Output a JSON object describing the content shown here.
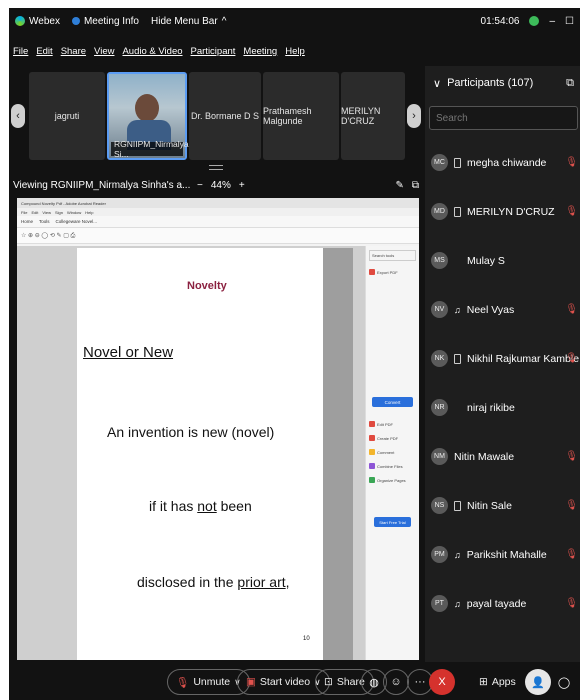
{
  "titlebar": {
    "app_name": "Webex",
    "meeting_info": "Meeting Info",
    "hide_menu": "Hide Menu Bar",
    "hide_menu_chevron": "^",
    "timer": "01:54:06",
    "minimize": "–",
    "maximize": "☐"
  },
  "menu": [
    "File",
    "Edit",
    "Share",
    "View",
    "Audio & Video",
    "Participant",
    "Meeting",
    "Help"
  ],
  "video_strip": {
    "tiles": [
      "jagruti",
      "RGNIIPM_Nirmalya Si...",
      "Dr. Bormane D S",
      "Prathamesh Malgunde",
      "MERILYN D'CRUZ"
    ],
    "left_arrow": "‹",
    "right_arrow": "›"
  },
  "viewing": {
    "title": "Viewing RGNIIPM_Nirmalya Sinha's a...",
    "zoom_out": "−",
    "zoom_level": "44%",
    "zoom_in": "+"
  },
  "shared_doc": {
    "browser_tab": "Compound Novelty Pdf - Adobe Acrobat Reader",
    "browser_menu": [
      "File",
      "Edit",
      "View",
      "Sign",
      "Window",
      "Help"
    ],
    "tabs": [
      "Home",
      "Tools",
      "Collegeware Novel..."
    ],
    "page_texts": {
      "heading": "Novelty",
      "subheading": "Novel or New",
      "line1": "An invention is new (novel)",
      "line2_prefix": "if it has ",
      "line2_underlined": "not",
      "line2_suffix": " been",
      "line3_prefix": "disclosed in the ",
      "line3_underlined": "prior art",
      "line3_suffix": ",",
      "page_number": "10"
    },
    "side_panel": {
      "search": "Search tools",
      "items": [
        "Export PDF",
        "Edit PDF",
        "Create PDF",
        "Comment",
        "Combine Files",
        "Organize Pages"
      ],
      "convert_button": "Convert",
      "free_trial": "Start Free Trial"
    }
  },
  "participants": {
    "title": "Participants (107)",
    "search_placeholder": "Search",
    "list": [
      {
        "initials": "MC",
        "name": "megha chiwande",
        "device": "phone",
        "muted": true
      },
      {
        "initials": "MD",
        "name": "MERILYN D'CRUZ",
        "device": "phone",
        "muted": true
      },
      {
        "initials": "MS",
        "name": "Mulay S",
        "device": "none",
        "muted": false
      },
      {
        "initials": "NV",
        "name": "Neel Vyas",
        "device": "headset",
        "muted": true
      },
      {
        "initials": "NK",
        "name": "Nikhil Rajkumar Kamble",
        "device": "phone",
        "muted": true
      },
      {
        "initials": "NR",
        "name": "niraj rikibe",
        "device": "none",
        "muted": false
      },
      {
        "initials": "NM",
        "name": "Nitin Mawale",
        "device": "none",
        "muted": true
      },
      {
        "initials": "NS",
        "name": "Nitin Sale",
        "device": "phone",
        "muted": true
      },
      {
        "initials": "PM",
        "name": "Parikshit Mahalle",
        "device": "headset",
        "muted": true
      },
      {
        "initials": "PT",
        "name": "payal tayade",
        "device": "headset",
        "muted": true
      }
    ]
  },
  "controls": {
    "unmute": "Unmute",
    "start_video": "Start video",
    "share": "Share",
    "apps": "Apps",
    "leave": "X",
    "dropdown": "∨"
  },
  "colors": {
    "accent_blue": "#5b9cf3",
    "mute_red": "#e0524d",
    "leave_red": "#d5322d",
    "heading_maroon": "#8b2140"
  }
}
